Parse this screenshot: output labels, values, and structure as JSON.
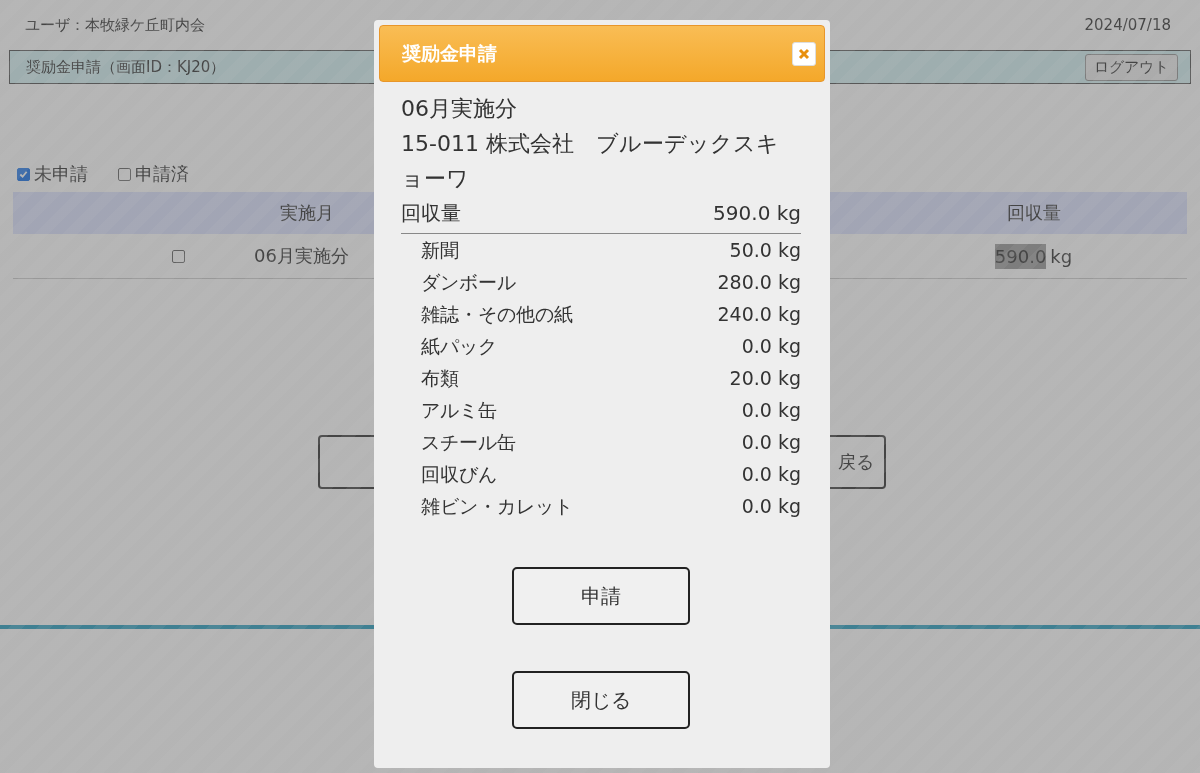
{
  "header": {
    "user": "ユーザ：本牧緑ケ丘町内会",
    "date": "2024/07/18"
  },
  "title_bar": {
    "title": "奨励金申請（画面ID：KJ20）",
    "logout": "ログアウト"
  },
  "filters": [
    {
      "label": "未申請",
      "checked": true
    },
    {
      "label": "申請済",
      "checked": false
    }
  ],
  "table": {
    "columns": [
      "実施月",
      "回収量"
    ],
    "rows": [
      {
        "checked": false,
        "month": "06月実施分",
        "amount": "590.0",
        "unit": "kg",
        "highlighted": true
      }
    ]
  },
  "buttons": [
    "戻る"
  ],
  "dialog": {
    "title": "奨励金申請",
    "period": "06月実施分",
    "company": "15-011 株式会社　ブルーデックスキョーワ",
    "total": {
      "label": "回収量",
      "value": "590.0 kg"
    },
    "items": [
      {
        "label": "新聞",
        "value": "50.0 kg"
      },
      {
        "label": "ダンボール",
        "value": "280.0 kg"
      },
      {
        "label": "雑誌・その他の紙",
        "value": "240.0 kg"
      },
      {
        "label": "紙パック",
        "value": "0.0 kg"
      },
      {
        "label": "布類",
        "value": "20.0 kg"
      },
      {
        "label": "アルミ缶",
        "value": "0.0 kg"
      },
      {
        "label": "スチール缶",
        "value": "0.0 kg"
      },
      {
        "label": "回収びん",
        "value": "0.0 kg"
      },
      {
        "label": "雑ビン・カレット",
        "value": "0.0 kg"
      }
    ],
    "buttons": [
      "申請",
      "閉じる"
    ]
  }
}
